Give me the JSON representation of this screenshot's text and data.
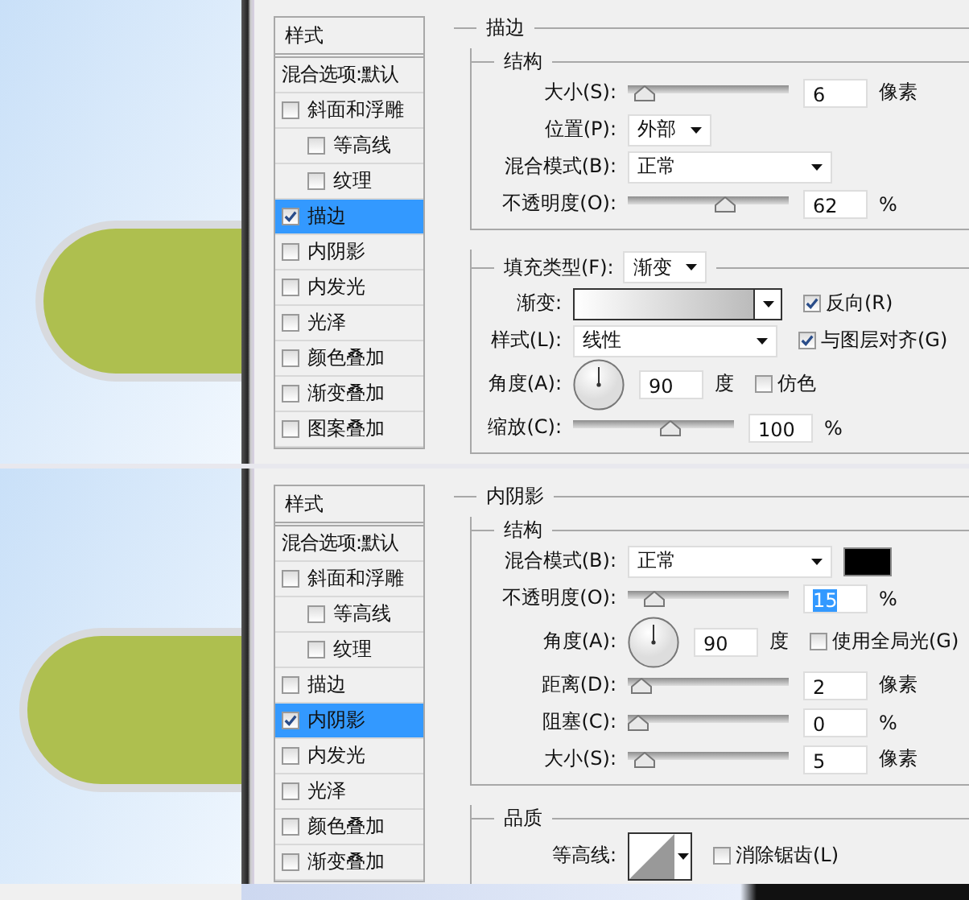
{
  "panels": [
    {
      "styles_header": "样式",
      "blend_options": "混合选项:默认",
      "styles": [
        {
          "label": "斜面和浮雕",
          "checked": false,
          "selected": false,
          "children": [
            {
              "label": "等高线",
              "checked": false,
              "selected": false
            },
            {
              "label": "纹理",
              "checked": false,
              "selected": false
            }
          ]
        },
        {
          "label": "描边",
          "checked": true,
          "selected": true
        },
        {
          "label": "内阴影",
          "checked": false,
          "selected": false
        },
        {
          "label": "内发光",
          "checked": false,
          "selected": false
        },
        {
          "label": "光泽",
          "checked": false,
          "selected": false
        },
        {
          "label": "颜色叠加",
          "checked": false,
          "selected": false
        },
        {
          "label": "渐变叠加",
          "checked": false,
          "selected": false
        },
        {
          "label": "图案叠加",
          "checked": false,
          "selected": false
        }
      ],
      "title": "描边",
      "groups": [
        {
          "title": "结构",
          "rows": [
            {
              "kind": "slider",
              "label": "大小(S):",
              "level": 0.05,
              "value": "6",
              "value_selected": false,
              "unit": "像素"
            },
            {
              "kind": "select",
              "label": "位置(P):",
              "value": "外部"
            },
            {
              "kind": "select_wide",
              "label": "混合模式(B):",
              "value": "正常"
            },
            {
              "kind": "slider",
              "label": "不透明度(O):",
              "level": 0.62,
              "value": "62",
              "value_selected": false,
              "unit": "%"
            }
          ]
        },
        {
          "title_select": {
            "label": "填充类型(F):",
            "value": "渐变"
          },
          "rows": [
            {
              "kind": "gradient",
              "label": "渐变:",
              "option": {
                "label": "反向(R)",
                "checked": true
              }
            },
            {
              "kind": "select_wide",
              "label": "样式(L):",
              "value": "线性",
              "option": {
                "label": "与图层对齐(G)",
                "checked": true
              }
            },
            {
              "kind": "angle",
              "label": "角度(A):",
              "value": "90",
              "unit": "度",
              "option": {
                "label": "仿色",
                "checked": false
              }
            },
            {
              "kind": "slider",
              "label": "缩放(C):",
              "level": 0.62,
              "value": "100",
              "value_selected": false,
              "unit": "%"
            }
          ]
        }
      ]
    },
    {
      "styles_header": "样式",
      "blend_options": "混合选项:默认",
      "styles": [
        {
          "label": "斜面和浮雕",
          "checked": false,
          "selected": false,
          "children": [
            {
              "label": "等高线",
              "checked": false,
              "selected": false
            },
            {
              "label": "纹理",
              "checked": false,
              "selected": false
            }
          ]
        },
        {
          "label": "描边",
          "checked": false,
          "selected": false
        },
        {
          "label": "内阴影",
          "checked": true,
          "selected": true
        },
        {
          "label": "内发光",
          "checked": false,
          "selected": false
        },
        {
          "label": "光泽",
          "checked": false,
          "selected": false
        },
        {
          "label": "颜色叠加",
          "checked": false,
          "selected": false
        },
        {
          "label": "渐变叠加",
          "checked": false,
          "selected": false
        }
      ],
      "title": "内阴影",
      "groups": [
        {
          "title": "结构",
          "rows": [
            {
              "kind": "select_wide",
              "label": "混合模式(B):",
              "value": "正常",
              "color": "#000000"
            },
            {
              "kind": "slider",
              "label": "不透明度(O):",
              "level": 0.12,
              "value": "15",
              "value_selected": true,
              "unit": "%"
            },
            {
              "kind": "angle",
              "label": "角度(A):",
              "value": "90",
              "unit": "度",
              "option": {
                "label": "使用全局光(G)",
                "checked": false
              }
            },
            {
              "kind": "slider",
              "label": "距离(D):",
              "level": 0.02,
              "value": "2",
              "value_selected": false,
              "unit": "像素"
            },
            {
              "kind": "slider",
              "label": "阻塞(C):",
              "level": 0,
              "value": "0",
              "value_selected": false,
              "unit": "%"
            },
            {
              "kind": "slider",
              "label": "大小(S):",
              "level": 0.05,
              "value": "5",
              "value_selected": false,
              "unit": "像素"
            }
          ]
        },
        {
          "title": "品质",
          "rows": [
            {
              "kind": "contour",
              "label": "等高线:",
              "option": {
                "label": "消除锯齿(L)",
                "checked": false
              }
            }
          ]
        }
      ]
    }
  ]
}
